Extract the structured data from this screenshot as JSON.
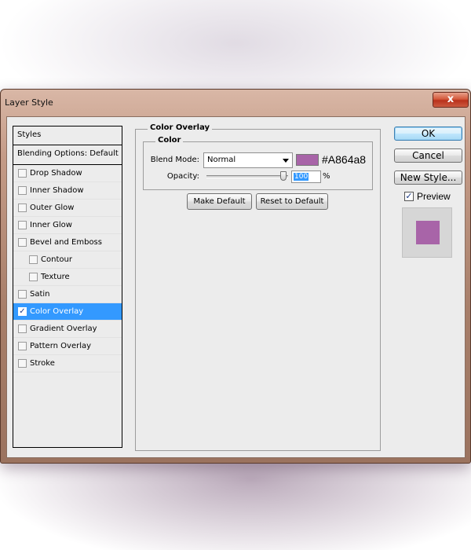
{
  "window": {
    "title": "Layer Style",
    "close_glyph": "x"
  },
  "styles_list": {
    "header": "Styles",
    "blending_options": "Blending Options: Default",
    "items": [
      {
        "label": "Drop Shadow",
        "checked": false,
        "indent": false
      },
      {
        "label": "Inner Shadow",
        "checked": false,
        "indent": false
      },
      {
        "label": "Outer Glow",
        "checked": false,
        "indent": false
      },
      {
        "label": "Inner Glow",
        "checked": false,
        "indent": false
      },
      {
        "label": "Bevel and Emboss",
        "checked": false,
        "indent": false
      },
      {
        "label": "Contour",
        "checked": false,
        "indent": true
      },
      {
        "label": "Texture",
        "checked": false,
        "indent": true
      },
      {
        "label": "Satin",
        "checked": false,
        "indent": false
      },
      {
        "label": "Color Overlay",
        "checked": true,
        "indent": false,
        "selected": true
      },
      {
        "label": "Gradient Overlay",
        "checked": false,
        "indent": false
      },
      {
        "label": "Pattern Overlay",
        "checked": false,
        "indent": false
      },
      {
        "label": "Stroke",
        "checked": false,
        "indent": false
      }
    ]
  },
  "panel": {
    "group_title": "Color Overlay",
    "subgroup_title": "Color",
    "blend_mode_label": "Blend Mode:",
    "blend_mode_value": "Normal",
    "color_hex": "#A864a8",
    "overlay_color": "#A864A8",
    "opacity_label": "Opacity:",
    "opacity_value": "100",
    "opacity_unit": "%",
    "opacity_fraction": 1.0,
    "make_default": "Make Default",
    "reset_default": "Reset to Default"
  },
  "actions": {
    "ok": "OK",
    "cancel": "Cancel",
    "new_style": "New Style...",
    "preview_label": "Preview",
    "preview_checked": true
  }
}
